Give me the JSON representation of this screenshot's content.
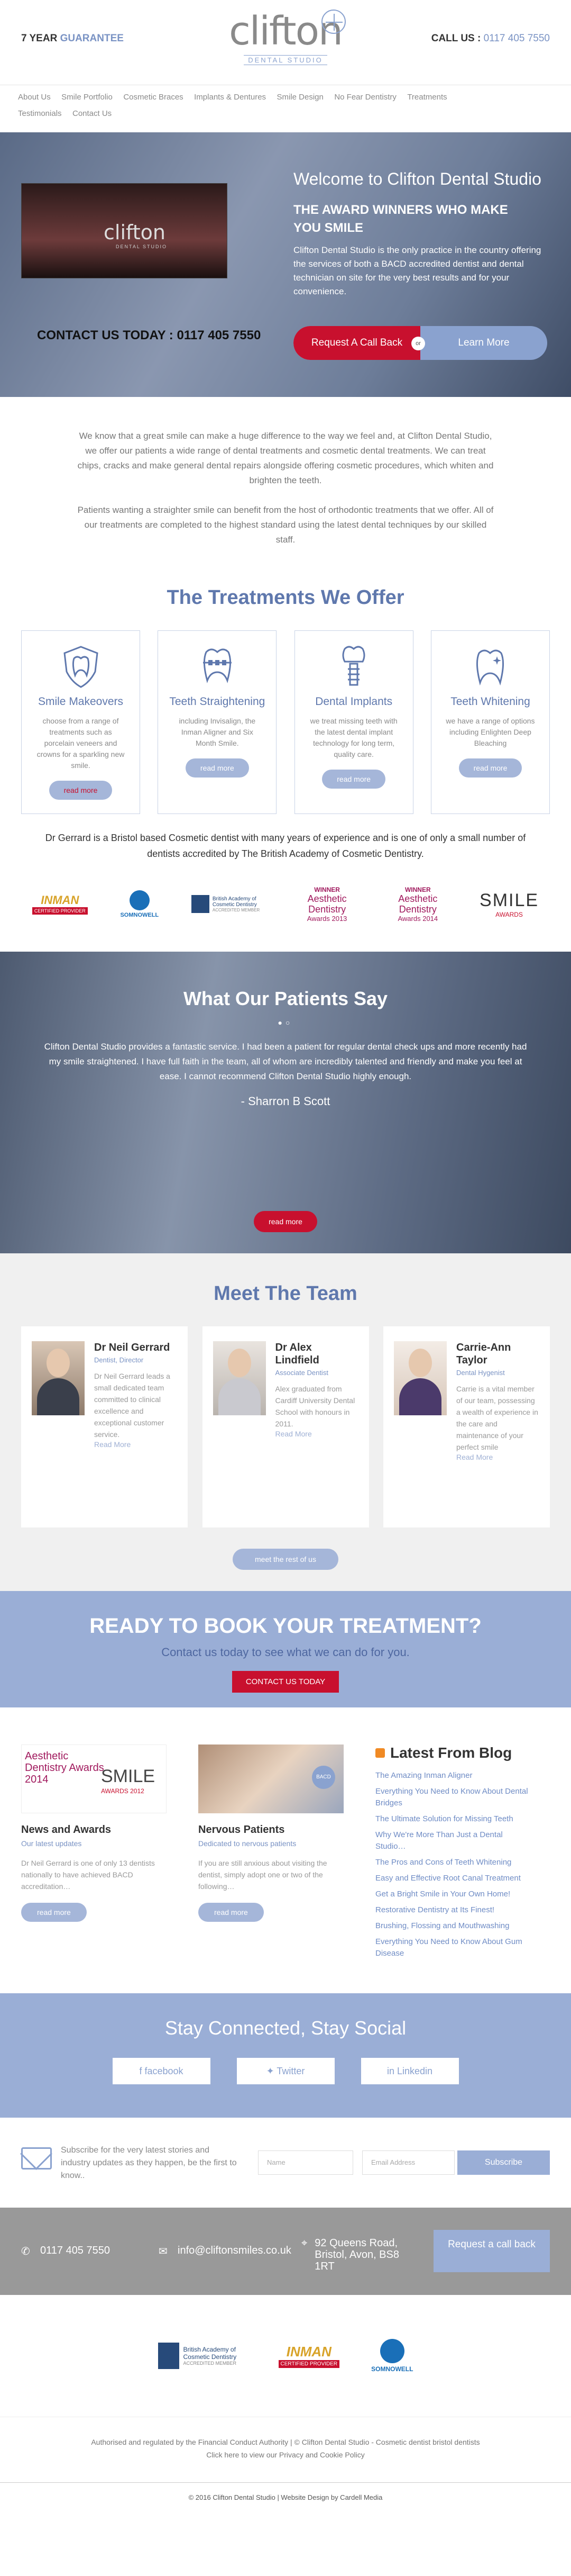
{
  "header": {
    "guarantee_prefix": "7 YEAR",
    "guarantee_highlight": "GUARANTEE",
    "logo_word": "clifton",
    "logo_sub": "DENTAL STUDIO",
    "call_label": "CALL US :",
    "call_number": "0117 405 7550"
  },
  "nav": {
    "items": [
      "About Us",
      "Smile Portfolio",
      "Cosmetic Braces",
      "Implants & Dentures",
      "Smile Design",
      "No Fear Dentistry",
      "Treatments",
      "Testimonials",
      "Contact Us"
    ]
  },
  "hero": {
    "video_logo": "clifton",
    "video_sub": "DENTAL STUDIO",
    "contact_label": "CONTACT US TODAY :",
    "contact_number": "0117 405 7550",
    "welcome": "Welcome to Clifton Dental Studio",
    "award_line": "THE AWARD WINNERS WHO MAKE YOU SMILE",
    "text": "Clifton Dental Studio is the only practice in the country offering the services of both a BACD accredited dentist and dental technician on site for the very best results and for your convenience.",
    "btn_callback": "Request A Call Back",
    "btn_or": "or",
    "btn_learn": "Learn More"
  },
  "intro": {
    "p1": "We know that a great smile can make a huge difference to the way we feel and, at Clifton Dental Studio, we offer our patients a wide range of dental treatments and cosmetic dental treatments. We can treat chips, cracks and make general dental repairs alongside offering cosmetic procedures, which whiten and brighten the teeth.",
    "p2": "Patients wanting a straighter smile can benefit from the host of orthodontic treatments that we offer. All of our treatments are completed to the highest standard using the latest dental techniques by our skilled staff."
  },
  "treatments": {
    "title": "The Treatments We Offer",
    "cards": [
      {
        "icon": "shield-tooth-icon",
        "title": "Smile Makeovers",
        "desc": "choose from a range of treatments such as porcelain veneers and crowns for a sparkling new smile.",
        "btn": "read more"
      },
      {
        "icon": "braces-tooth-icon",
        "title": "Teeth Straightening",
        "desc": "including Invisalign, the Inman Aligner and Six Month Smile.",
        "btn": "read more"
      },
      {
        "icon": "implant-tooth-icon",
        "title": "Dental Implants",
        "desc": "we treat missing teeth with the latest dental implant technology for long term, quality care.",
        "btn": "read more"
      },
      {
        "icon": "sparkle-tooth-icon",
        "title": "Teeth Whitening",
        "desc": "we have a range of options including Enlighten Deep Bleaching",
        "btn": "read more"
      }
    ],
    "gerrard": "Dr Gerrard is a Bristol based Cosmetic dentist with many years of experience and is one of only a small number of dentists accredited by The British Academy of Cosmetic Dentistry."
  },
  "awards": {
    "a1": "INMAN",
    "a1_sub": "CERTIFIED PROVIDER",
    "a2": "SOMNOWELL",
    "a3": "British Academy of Cosmetic Dentistry",
    "a3_sub": "ACCREDITED MEMBER",
    "a4_top": "WINNER",
    "a4": "Aesthetic Dentistry",
    "a4_sub": "Awards 2013",
    "a5_top": "WINNER",
    "a5": "Aesthetic Dentistry",
    "a5_sub": "Awards 2014",
    "a6": "SMILE",
    "a6_sub": "AWARDS"
  },
  "testimonial": {
    "title": "What Our Patients Say",
    "quote": "Clifton Dental Studio provides a fantastic service. I had been a patient for regular dental check ups and more recently had my smile straightened. I have full faith in the team, all of whom are incredibly talented and friendly and make you feel at ease. I cannot recommend Clifton Dental Studio highly enough.",
    "author": "- Sharron B Scott",
    "btn": "read more"
  },
  "team": {
    "title": "Meet The Team",
    "members": [
      {
        "name": "Dr Neil Gerrard",
        "role": "Dentist, Director",
        "desc": "Dr Neil Gerrard leads a small dedicated team committed to clinical excellence and exceptional customer service.",
        "more": "Read More"
      },
      {
        "name": "Dr Alex Lindfield",
        "role": "Associate Dentist",
        "desc": "Alex graduated from Cardiff University Dental School with honours in 2011.",
        "more": "Read More"
      },
      {
        "name": "Carrie-Ann Taylor",
        "role": "Dental Hygenist",
        "desc": "Carrie is a vital member of our team, possessing a wealth of experience in the care and maintenance of your perfect smile",
        "more": "Read More"
      }
    ],
    "btn": "meet the rest of us"
  },
  "cta": {
    "title": "READY TO BOOK YOUR TREATMENT?",
    "sub": "Contact us today to see what we can do for you.",
    "btn": "CONTACT US TODAY"
  },
  "news": {
    "cards": [
      {
        "title": "News and Awards",
        "sub": "Our latest updates",
        "desc": "Dr Neil Gerrard is one of only 13 dentists nationally to have achieved BACD accreditation…",
        "btn": "read more"
      },
      {
        "title": "Nervous Patients",
        "sub": "Dedicated to nervous patients",
        "desc": "If you are still anxious about visiting the dentist, simply adopt one or two of the following…",
        "btn": "read more"
      }
    ],
    "img1_a": "Aesthetic Dentistry Awards 2014",
    "img1_b": "SMILE",
    "img1_c": "AWARDS 2012",
    "img2_badge": "BACD"
  },
  "blog": {
    "title": "Latest From Blog",
    "links": [
      "The Amazing Inman Aligner",
      "Everything You Need to Know About Dental Bridges",
      "The Ultimate Solution for Missing Teeth",
      "Why We're More Than Just a Dental Studio…",
      "The Pros and Cons of Teeth Whitening",
      "Easy and Effective Root Canal Treatment",
      "Get a Bright Smile in Your Own Home!",
      "Restorative Dentistry at Its Finest!",
      "Brushing, Flossing and Mouthwashing",
      "Everything You Need to Know About Gum Disease"
    ]
  },
  "social": {
    "title": "Stay Connected, Stay Social",
    "facebook": "facebook",
    "twitter": "Twitter",
    "linkedin": "Linkedin"
  },
  "subscribe": {
    "text": "Subscribe for the very latest stories and industry updates as they happen, be the first to know..",
    "name_placeholder": "Name",
    "email_placeholder": "Email Address",
    "btn": "Subscribe"
  },
  "contact_bar": {
    "phone": "0117 405 7550",
    "email": "info@cliftonsmiles.co.uk",
    "address": "92 Queens Road, Bristol, Avon, BS8 1RT",
    "btn": "Request a call back"
  },
  "footer_logos": {
    "l1": "British Academy of Cosmetic Dentistry",
    "l1_sub": "ACCREDITED MEMBER",
    "l2": "INMAN",
    "l2_sub": "CERTIFIED PROVIDER",
    "l3": "SOMNOWELL"
  },
  "legal": {
    "line1": "Authorised and regulated by the Financial Conduct Authority | © Clifton Dental Studio - Cosmetic dentist bristol dentists",
    "line2": "Click here to view our Privacy and Cookie Policy"
  },
  "copyright": "© 2016 Clifton Dental Studio | Website Design by Cardell Media"
}
